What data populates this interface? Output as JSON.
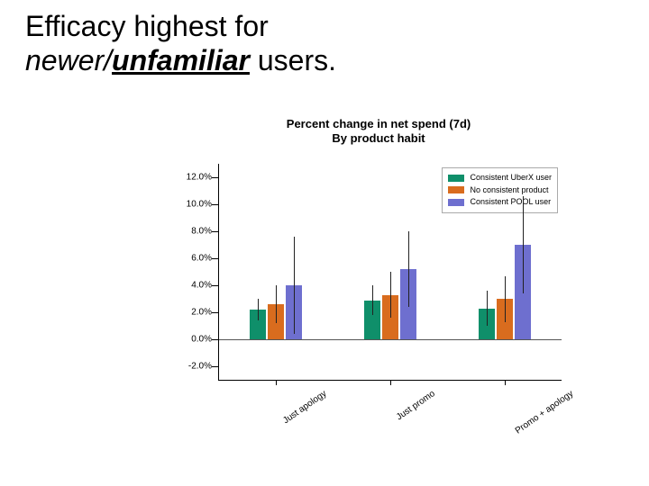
{
  "headline": {
    "prefix": "Efficacy highest for ",
    "ital": "newer/",
    "under": "unfamiliar",
    "suffix": " users."
  },
  "chart_data": {
    "type": "bar",
    "title_line1": "Percent change in net spend (7d)",
    "title_line2": "By product habit",
    "categories": [
      "Just apology",
      "Just promo",
      "Promo + apology"
    ],
    "series": [
      {
        "name": "Consistent UberX user",
        "color": "#0f8f6a",
        "values": [
          2.2,
          2.9,
          2.3
        ],
        "err_low": [
          1.4,
          1.8,
          1.0
        ],
        "err_high": [
          3.0,
          4.0,
          3.6
        ]
      },
      {
        "name": "No consistent product",
        "color": "#d96c1e",
        "values": [
          2.6,
          3.3,
          3.0
        ],
        "err_low": [
          1.2,
          1.6,
          1.3
        ],
        "err_high": [
          4.0,
          5.0,
          4.7
        ]
      },
      {
        "name": "Consistent POOL user",
        "color": "#6e6fcf",
        "values": [
          4.0,
          5.2,
          7.0
        ],
        "err_low": [
          0.4,
          2.4,
          3.4
        ],
        "err_high": [
          7.6,
          8.0,
          10.6
        ]
      }
    ],
    "ylim": [
      -3,
      13
    ],
    "yticks": [
      -2,
      0,
      2,
      4,
      6,
      8,
      10,
      12
    ],
    "ytick_labels": [
      "-2.0%",
      "0.0%",
      "2.0%",
      "4.0%",
      "6.0%",
      "8.0%",
      "10.0%",
      "12.0%"
    ]
  }
}
